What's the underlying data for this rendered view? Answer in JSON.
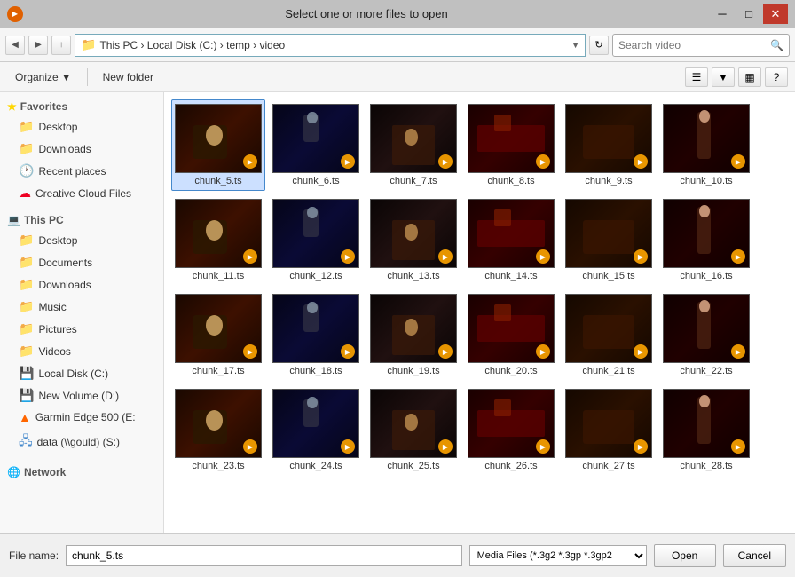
{
  "titleBar": {
    "title": "Select one or more files to open",
    "minBtn": "─",
    "maxBtn": "□",
    "closeBtn": "✕"
  },
  "addressBar": {
    "path": "This PC  ›  Local Disk (C:)  ›  temp  ›  video",
    "searchPlaceholder": "Search video",
    "refreshBtn": "↻"
  },
  "toolbar": {
    "organizeLabel": "Organize",
    "newFolderLabel": "New folder"
  },
  "sidebar": {
    "favoritesLabel": "Favorites",
    "favorites": [
      {
        "label": "Desktop",
        "icon": "folder"
      },
      {
        "label": "Downloads",
        "icon": "folder"
      },
      {
        "label": "Recent places",
        "icon": "folder"
      },
      {
        "label": "Creative Cloud Files",
        "icon": "cc"
      }
    ],
    "thisPC": "This PC",
    "thisPCItems": [
      {
        "label": "Desktop",
        "icon": "folder"
      },
      {
        "label": "Documents",
        "icon": "folder"
      },
      {
        "label": "Downloads",
        "icon": "folder"
      },
      {
        "label": "Music",
        "icon": "folder"
      },
      {
        "label": "Pictures",
        "icon": "folder"
      },
      {
        "label": "Videos",
        "icon": "folder"
      },
      {
        "label": "Local Disk (C:)",
        "icon": "drive"
      },
      {
        "label": "New Volume (D:)",
        "icon": "drive"
      },
      {
        "label": "Garmin Edge 500 (E:",
        "icon": "triangle"
      },
      {
        "label": "data (\\\\gould) (S:)",
        "icon": "network"
      }
    ],
    "networkLabel": "Network"
  },
  "files": [
    "chunk_5.ts",
    "chunk_6.ts",
    "chunk_7.ts",
    "chunk_8.ts",
    "chunk_9.ts",
    "chunk_10.ts",
    "chunk_11.ts",
    "chunk_12.ts",
    "chunk_13.ts",
    "chunk_14.ts",
    "chunk_15.ts",
    "chunk_16.ts",
    "chunk_17.ts",
    "chunk_18.ts",
    "chunk_19.ts",
    "chunk_20.ts",
    "chunk_21.ts",
    "chunk_22.ts",
    "chunk_23.ts",
    "chunk_24.ts",
    "chunk_25.ts",
    "chunk_26.ts",
    "chunk_27.ts",
    "chunk_28.ts"
  ],
  "bottomBar": {
    "fileNameLabel": "File name:",
    "fileNameValue": "chunk_5.ts",
    "fileTypeValue": "Media Files (*.3g2 *.3gp *.3gp2",
    "openLabel": "Open",
    "cancelLabel": "Cancel"
  }
}
